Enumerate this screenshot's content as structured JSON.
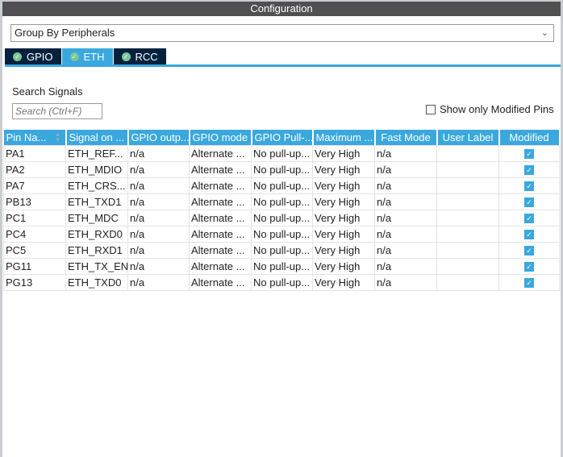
{
  "title": "Configuration",
  "group_by": "Group By Peripherals",
  "tabs": [
    {
      "label": "GPIO"
    },
    {
      "label": "ETH"
    },
    {
      "label": "RCC"
    }
  ],
  "search_label": "Search Signals",
  "search_placeholder": "Search (Ctrl+F)",
  "show_modified": "Show only Modified Pins",
  "columns": [
    "Pin Na...",
    "Signal on ...",
    "GPIO outp...",
    "GPIO mode",
    "GPIO Pull-...",
    "Maximum ...",
    "Fast Mode",
    "User Label",
    "Modified"
  ],
  "rows": [
    [
      "PA1",
      "ETH_REF...",
      "n/a",
      "Alternate ...",
      "No pull-up...",
      "Very High",
      "n/a",
      ""
    ],
    [
      "PA2",
      "ETH_MDIO",
      "n/a",
      "Alternate ...",
      "No pull-up...",
      "Very High",
      "n/a",
      ""
    ],
    [
      "PA7",
      "ETH_CRS...",
      "n/a",
      "Alternate ...",
      "No pull-up...",
      "Very High",
      "n/a",
      ""
    ],
    [
      "PB13",
      "ETH_TXD1",
      "n/a",
      "Alternate ...",
      "No pull-up...",
      "Very High",
      "n/a",
      ""
    ],
    [
      "PC1",
      "ETH_MDC",
      "n/a",
      "Alternate ...",
      "No pull-up...",
      "Very High",
      "n/a",
      ""
    ],
    [
      "PC4",
      "ETH_RXD0",
      "n/a",
      "Alternate ...",
      "No pull-up...",
      "Very High",
      "n/a",
      ""
    ],
    [
      "PC5",
      "ETH_RXD1",
      "n/a",
      "Alternate ...",
      "No pull-up...",
      "Very High",
      "n/a",
      ""
    ],
    [
      "PG11",
      "ETH_TX_EN",
      "n/a",
      "Alternate ...",
      "No pull-up...",
      "Very High",
      "n/a",
      ""
    ],
    [
      "PG13",
      "ETH_TXD0",
      "n/a",
      "Alternate ...",
      "No pull-up...",
      "Very High",
      "n/a",
      ""
    ]
  ]
}
